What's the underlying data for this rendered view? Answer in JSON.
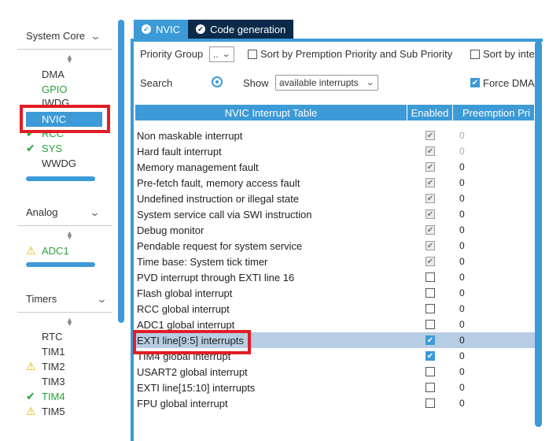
{
  "sidebar": {
    "categories": [
      {
        "title": "System Core"
      },
      {
        "title": "Analog"
      },
      {
        "title": "Timers"
      }
    ],
    "system_core_items": [
      {
        "label": "DMA",
        "status": ""
      },
      {
        "label": "GPIO",
        "status": "ok"
      },
      {
        "label": "IWDG",
        "status": ""
      },
      {
        "label": "NVIC",
        "status": "selected"
      },
      {
        "label": "RCC",
        "status": "ok"
      },
      {
        "label": "SYS",
        "status": "ok"
      },
      {
        "label": "WWDG",
        "status": ""
      }
    ],
    "analog_items": [
      {
        "label": "ADC1",
        "status": "warning"
      }
    ],
    "timer_items": [
      {
        "label": "RTC",
        "status": ""
      },
      {
        "label": "TIM1",
        "status": ""
      },
      {
        "label": "TIM2",
        "status": "warning"
      },
      {
        "label": "TIM3",
        "status": ""
      },
      {
        "label": "TIM4",
        "status": "ok"
      },
      {
        "label": "TIM5",
        "status": "warning"
      }
    ]
  },
  "tabs": [
    {
      "label": "NVIC",
      "active": true
    },
    {
      "label": "Code generation",
      "active": false
    }
  ],
  "options": {
    "priority_group_label": "Priority Group",
    "priority_group_value": "..",
    "sort_label": "Sort by Premption Priority and Sub Priority",
    "sort_by_label": "Sort by inte",
    "search_label": "Search",
    "show_label": "Show",
    "show_value": "available interrupts",
    "force_dma_label": "Force DMA"
  },
  "table": {
    "headers": [
      "NVIC Interrupt Table",
      "Enabled",
      "Preemption Pri"
    ],
    "rows": [
      {
        "name": "Non maskable interrupt",
        "enabled": true,
        "locked": true,
        "priority": "0"
      },
      {
        "name": "Hard fault interrupt",
        "enabled": true,
        "locked": true,
        "priority": "0"
      },
      {
        "name": "Memory management fault",
        "enabled": true,
        "locked": true,
        "priority": "0"
      },
      {
        "name": "Pre-fetch fault, memory access fault",
        "enabled": true,
        "locked": true,
        "priority": "0"
      },
      {
        "name": "Undefined instruction or illegal state",
        "enabled": true,
        "locked": true,
        "priority": "0"
      },
      {
        "name": "System service call via SWI instruction",
        "enabled": true,
        "locked": true,
        "priority": "0"
      },
      {
        "name": "Debug monitor",
        "enabled": true,
        "locked": true,
        "priority": "0"
      },
      {
        "name": "Pendable request for system service",
        "enabled": true,
        "locked": true,
        "priority": "0"
      },
      {
        "name": "Time base: System tick timer",
        "enabled": true,
        "locked": true,
        "priority": "0"
      },
      {
        "name": "PVD interrupt through EXTI line 16",
        "enabled": false,
        "locked": false,
        "priority": "0"
      },
      {
        "name": "Flash global interrupt",
        "enabled": false,
        "locked": false,
        "priority": "0"
      },
      {
        "name": "RCC global interrupt",
        "enabled": false,
        "locked": false,
        "priority": "0"
      },
      {
        "name": "ADC1 global interrupt",
        "enabled": false,
        "locked": false,
        "priority": "0"
      },
      {
        "name": "EXTI line[9:5] interrupts",
        "enabled": true,
        "locked": false,
        "priority": "0"
      },
      {
        "name": "TIM4 global interrupt",
        "enabled": true,
        "locked": false,
        "priority": "0"
      },
      {
        "name": "USART2 global interrupt",
        "enabled": false,
        "locked": false,
        "priority": "0"
      },
      {
        "name": "EXTI line[15:10] interrupts",
        "enabled": false,
        "locked": false,
        "priority": "0"
      },
      {
        "name": "FPU global interrupt",
        "enabled": false,
        "locked": false,
        "priority": "0"
      }
    ]
  },
  "colors": {
    "accent": "#3c9ad7",
    "dark_tab": "#0b2a4a",
    "highlight_box": "#e11d25",
    "ok": "#2aa23a",
    "warning": "#e6b300",
    "selected_row": "#b7cde3"
  }
}
